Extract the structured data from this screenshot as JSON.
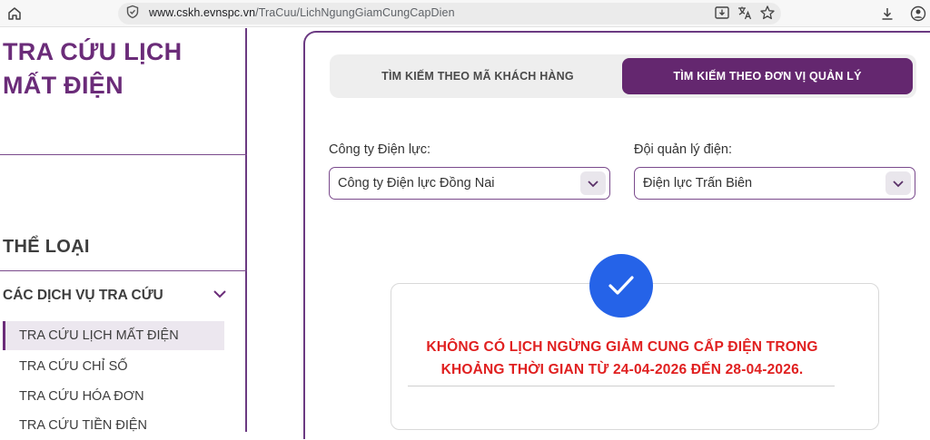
{
  "browser": {
    "url_host": "www.cskh.evnspc.vn",
    "url_path": "/TraCuu/LichNgungGiamCungCapDien"
  },
  "sidebar": {
    "title": "TRA CỨU LỊCH MẤT ĐIỆN",
    "category_heading": "THỂ LOẠI",
    "accordion_label": "CÁC DỊCH VỤ TRA CỨU",
    "items": [
      {
        "label": "TRA CỨU LỊCH MẤT ĐIỆN",
        "active": true
      },
      {
        "label": "TRA CỨU CHỈ SỐ",
        "active": false
      },
      {
        "label": "TRA CỨU HÓA ĐƠN",
        "active": false
      },
      {
        "label": "TRA CỨU TIỀN ĐIỆN",
        "active": false
      }
    ]
  },
  "tabs": {
    "customer": "TÌM KIẾM THEO MÃ KHÁCH HÀNG",
    "unit": "TÌM KIẾM THEO ĐƠN VỊ QUẢN LÝ",
    "active": "unit"
  },
  "form": {
    "company_label": "Công ty Điện lực:",
    "company_value": "Công ty Điện lực Đồng Nai",
    "team_label": "Đội quản lý điện:",
    "team_value": "Điện lực Trấn Biên"
  },
  "result": {
    "line1": "KHÔNG CÓ LỊCH NGỪNG GIẢM CUNG CẤP ĐIỆN TRONG",
    "line2": "KHOẢNG THỜI GIAN TỪ 24-04-2026 ĐẾN 28-04-2026."
  },
  "colors": {
    "brand_purple": "#64276f",
    "alert_red": "#e02020",
    "check_blue": "#2563e8"
  },
  "icons": [
    "home-icon",
    "tune-icon",
    "download-page-icon",
    "translate-icon",
    "star-icon",
    "download-icon",
    "profile-icon",
    "chevron-down-icon",
    "check-icon"
  ]
}
